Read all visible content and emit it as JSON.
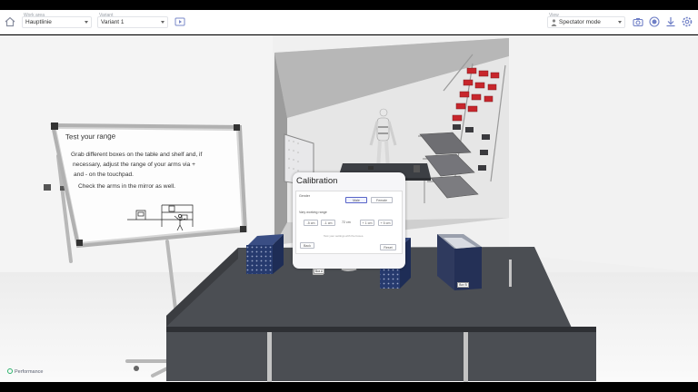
{
  "toolbar": {
    "workarea_label": "Work area",
    "workarea_value": "Hauptlinie",
    "variant_label": "Variant",
    "variant_value": "Variant 1",
    "view_label": "View",
    "view_value": "Spectator mode",
    "icons": [
      "home-icon",
      "play-icon",
      "camera-icon",
      "record-icon",
      "download-icon",
      "settings-icon"
    ]
  },
  "whiteboard": {
    "title": "Test your range",
    "lines": [
      "Grab different boxes on the table and shelf and, if",
      "necessary, adjust the range of your arms via +",
      "and - on the touchpad.",
      "Check the arms in the mirror as well."
    ]
  },
  "calibration": {
    "title": "Calibration",
    "gender_label": "Gender",
    "gender_options": [
      "Male",
      "Female"
    ],
    "selected_gender": "Male",
    "range_label": "Vary working range",
    "range_options": [
      "-5 cm",
      "-1 cm",
      "-1 cm",
      "+ 1 cm",
      "+ 5 cm"
    ],
    "range_value": "72 cm",
    "hint": "Test your settings with the boxes.",
    "back_label": "Back",
    "reset_label": "Reset"
  },
  "box_labels": [
    "Box A",
    "Box B"
  ],
  "status": {
    "performance_label": "Performance",
    "accent_color": "#2db36c"
  }
}
